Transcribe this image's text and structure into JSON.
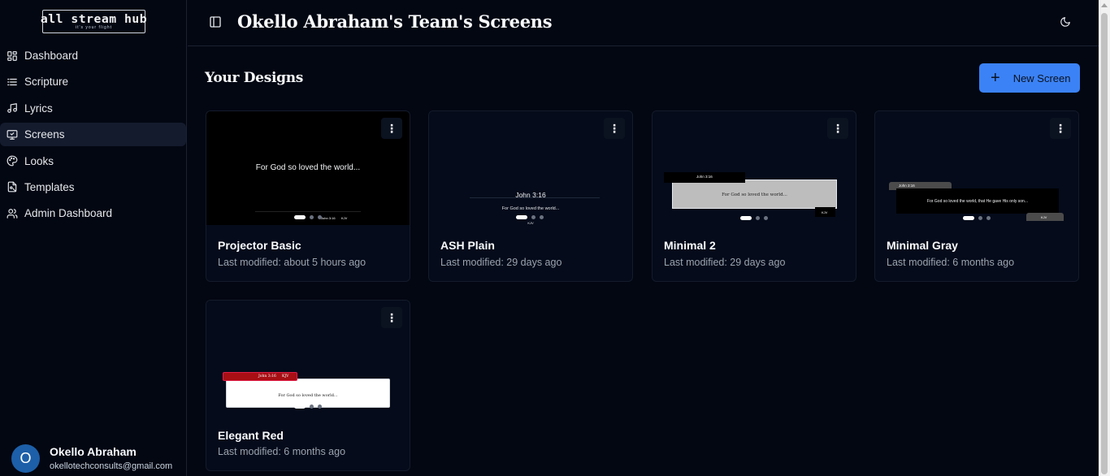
{
  "app": {
    "logo_name": "all stream hub",
    "logo_tagline": "it's your flight"
  },
  "sidebar": {
    "items": [
      {
        "label": "Dashboard",
        "icon": "dashboard-icon"
      },
      {
        "label": "Scripture",
        "icon": "list-icon"
      },
      {
        "label": "Lyrics",
        "icon": "music-icon"
      },
      {
        "label": "Screens",
        "icon": "monitor-icon"
      },
      {
        "label": "Looks",
        "icon": "palette-icon"
      },
      {
        "label": "Templates",
        "icon": "file-icon"
      },
      {
        "label": "Admin Dashboard",
        "icon": "users-icon"
      }
    ],
    "active_item": "Screens"
  },
  "user": {
    "initial": "O",
    "name": "Okello Abraham",
    "email": "okellotechconsults@gmail.com"
  },
  "header": {
    "title": "Okello Abraham's Team's Screens"
  },
  "main": {
    "section_title": "Your Designs",
    "new_button_label": "New Screen",
    "cards": [
      {
        "title": "Projector Basic",
        "meta": "Last modified: about 5 hours ago",
        "preview": {
          "text": "For God so loved the world...",
          "reference": "John 3:16",
          "version": "KJV"
        }
      },
      {
        "title": "ASH Plain",
        "meta": "Last modified: 29 days ago",
        "preview": {
          "reference": "John 3:16",
          "text": "For God so loved the world...",
          "version": "KJV"
        }
      },
      {
        "title": "Minimal 2",
        "meta": "Last modified: 29 days ago",
        "preview": {
          "reference": "John 3:16",
          "text": "For God so loved the world...",
          "version": "KJV"
        }
      },
      {
        "title": "Minimal Gray",
        "meta": "Last modified: 6 months ago",
        "preview": {
          "reference": "John 3:16",
          "text": "For God so loved the world, that He gave His only son...",
          "version": "KJV"
        }
      },
      {
        "title": "Elegant Red",
        "meta": "Last modified: 6 months ago",
        "preview": {
          "reference": "John 3:16",
          "version": "KJV",
          "text": "For God so loved the world..."
        }
      }
    ],
    "menu_glyph": "⋮"
  },
  "colors": {
    "background": "#030712",
    "accent": "#3b82f6",
    "card_bg": "#050b1a",
    "elegant_red": "#a80f14"
  }
}
